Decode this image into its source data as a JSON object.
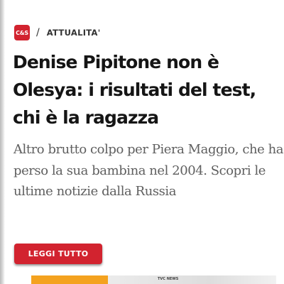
{
  "source": {
    "logo_text": "C&S",
    "logo_color": "#d2232f",
    "separator": "/",
    "category": "ATTUALITA'"
  },
  "article": {
    "headline": "Denise Pipitone non è Olesya: i risultati del test, chi è la ragazza",
    "summary": "Altro brutto colpo per Piera Maggio, che ha perso la sua bambina nel 2004. Scopri le ultime notizie dalla Russia"
  },
  "actions": {
    "read_more_label": "LEGGI TUTTO",
    "button_color": "#d2232f"
  },
  "thumbnail": {
    "caption": "TVC NEWS",
    "accent_color": "#f4a21f"
  }
}
